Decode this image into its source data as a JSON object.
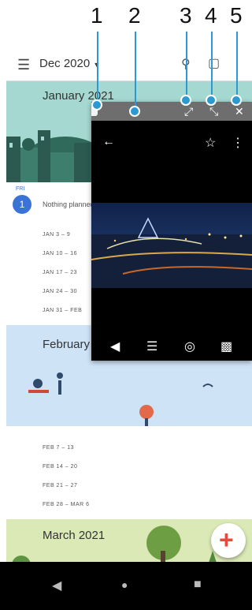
{
  "callouts": [
    "1",
    "2",
    "3",
    "4",
    "5"
  ],
  "calendar": {
    "month_title": "Dec 2020",
    "menu_icon": "menu-icon",
    "banners": {
      "january": "January 2021",
      "february": "February",
      "march": "March 2021"
    },
    "day": {
      "weekday": "FRI",
      "date": "1",
      "event": "Nothing planned"
    },
    "jan_weeks": [
      "JAN 3 – 9",
      "JAN 10 – 16",
      "JAN 17 – 23",
      "JAN 24 – 30",
      "JAN 31 – FEB"
    ],
    "feb_weeks": [
      "FEB 7 – 13",
      "FEB 14 – 20",
      "FEB 21 – 27",
      "FEB 28 – MAR 6"
    ]
  },
  "floating_window": {
    "icons": [
      "back-icon",
      "star-icon",
      "info-icon",
      "share-icon",
      "edit-icon",
      "lens-icon",
      "delete-icon"
    ]
  },
  "colors": {
    "january_banner": "#a4d8d0",
    "february_banner": "#cfe3f7",
    "march_banner": "#dbe9b6",
    "callout_accent": "#2b9ad3",
    "fab_plus": "#e64a3c"
  }
}
